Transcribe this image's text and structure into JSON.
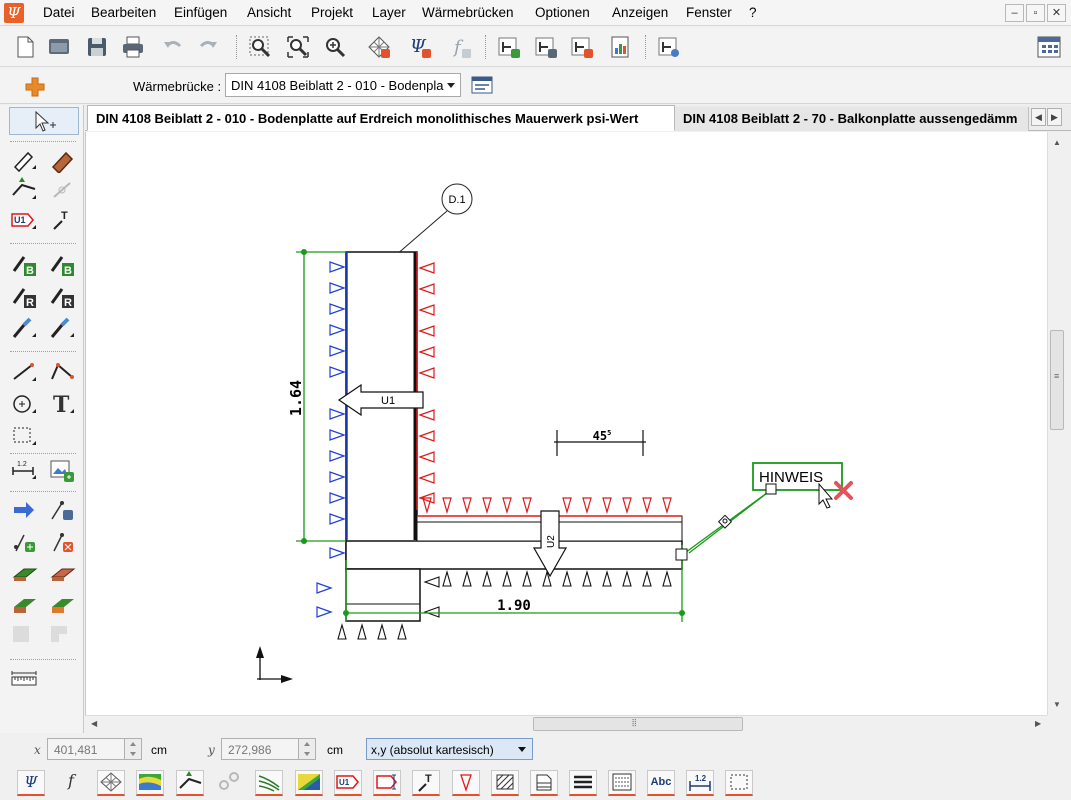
{
  "menu": [
    "Datei",
    "Bearbeiten",
    "Einfügen",
    "Ansicht",
    "Projekt",
    "Layer",
    "Wärmebrücken",
    "Optionen",
    "Anzeigen",
    "Fenster",
    "?"
  ],
  "app_logo": "Ψ",
  "window_controls": {
    "minimize": "–",
    "restore": "▫",
    "close": "✕"
  },
  "toolbar2": {
    "label": "Wärmebrücke :",
    "selected": "DIN 4108 Beiblatt 2 - 010 - Bodenpla"
  },
  "tabs": [
    {
      "label": "DIN 4108 Beiblatt 2 - 010 - Bodenplatte auf Erdreich monolithisches Mauerwerk psi-Wert"
    },
    {
      "label": "DIN 4108 Beiblatt 2 - 70 - Balkonplatte aussengedämm"
    }
  ],
  "drawing": {
    "detail_marker": "D.1",
    "u1_label": "U1",
    "u2_label": "U2",
    "dim_vertical": "1.64",
    "dim_horizontal": "1.90",
    "dim_short": "45",
    "dim_short_sup": "5",
    "hint_label": "HINWEIS"
  },
  "coordinates": {
    "x_label": "x",
    "x_value": "401,481",
    "x_unit": "cm",
    "y_label": "y",
    "y_value": "272,986",
    "y_unit": "cm",
    "mode": "x,y (absolut kartesisch)"
  },
  "bottom_tools": {
    "psi": "Ψ",
    "f": "f",
    "u1": "U1",
    "abc": "Abc",
    "dim": "1.2"
  },
  "colors": {
    "accent_orange": "#e2532c",
    "boundary_blue": "#1f3fd6",
    "boundary_red": "#e01818",
    "dimension_green": "#1a9a1a"
  }
}
